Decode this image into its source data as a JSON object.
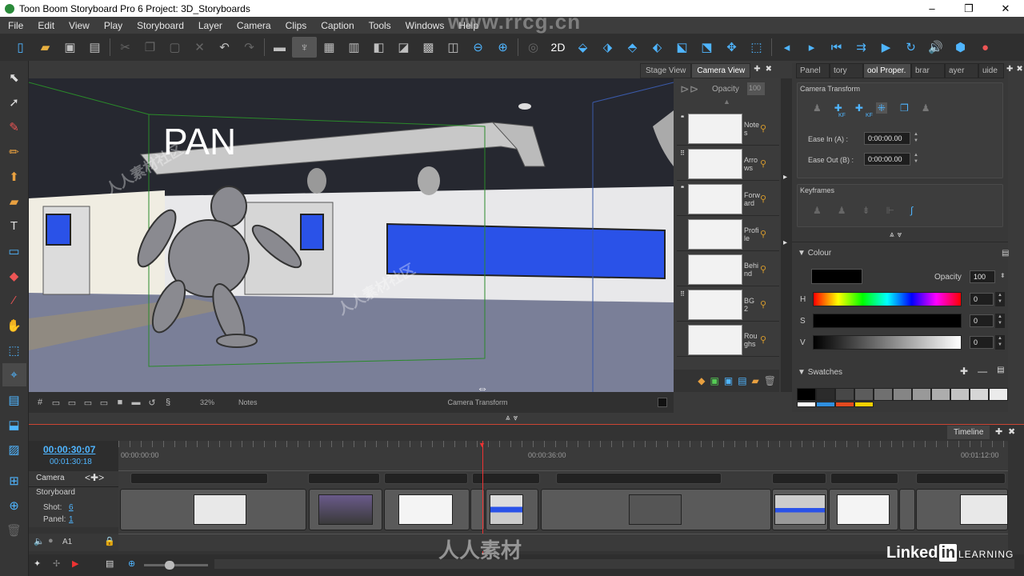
{
  "window": {
    "title": "Toon Boom Storyboard Pro 6 Project: 3D_Storyboards",
    "controls": {
      "minimize": "–",
      "maximize": "❐",
      "close": "✕"
    }
  },
  "menu": [
    "File",
    "Edit",
    "View",
    "Play",
    "Storyboard",
    "Layer",
    "Camera",
    "Clips",
    "Caption",
    "Tools",
    "Windows",
    "Help"
  ],
  "toolbar": {
    "icons": [
      "new-project-icon",
      "open-project-icon",
      "save-icon",
      "save-all-icon",
      "cut-icon",
      "copy-icon",
      "paste-icon",
      "delete-icon",
      "undo-icon",
      "redo-icon",
      "menu-icon",
      "light-table-icon",
      "grid-icon",
      "layout-icon",
      "layout2-icon",
      "layout3-icon",
      "thumbnails-icon",
      "panel-view-icon",
      "zoom-out-icon",
      "zoom-in-icon",
      "3d-mode-icon",
      "2d-label",
      "camera-icon",
      "camera2-icon",
      "camera3-icon",
      "camera4-icon",
      "camera5-icon",
      "camera6-icon",
      "camera7-icon",
      "prev-icon",
      "next-icon",
      "first-frame-icon",
      "playback-icon",
      "play-icon",
      "loop-icon",
      "sound-icon",
      "sound-scrub-icon",
      "render-icon"
    ],
    "label_2d": "2D"
  },
  "stage": {
    "tabs": [
      {
        "label": "Stage View",
        "active": false
      },
      {
        "label": "Camera View",
        "active": true
      }
    ],
    "caption_text": "PAN",
    "zoom": "32%",
    "notes_label": "Notes",
    "camera_transform_label": "Camera Transform"
  },
  "layers": {
    "opacity_label": "Opacity",
    "opacity_value": "100",
    "items": [
      {
        "name": "Notes"
      },
      {
        "name": "Arrows"
      },
      {
        "name": "Forward"
      },
      {
        "name": "Profile"
      },
      {
        "name": "Behind"
      },
      {
        "name": "BG 2"
      },
      {
        "name": "Roughs"
      }
    ]
  },
  "properties": {
    "tabs": [
      {
        "label": "Panel",
        "active": false
      },
      {
        "label": "tory",
        "active": false
      },
      {
        "label": "ool Proper.",
        "active": true
      },
      {
        "label": "brar",
        "active": false
      },
      {
        "label": "ayer",
        "active": false
      },
      {
        "label": "uide",
        "active": false
      }
    ],
    "camera_transform": {
      "title": "Camera Transform",
      "ease_in_label": "Ease In (A) :",
      "ease_in_value": "0:00:00.00",
      "ease_out_label": "Ease Out (B) :",
      "ease_out_value": "0:00:00.00",
      "kf_label": "KF"
    },
    "keyframes": {
      "title": "Keyframes"
    },
    "colour": {
      "title": "Colour",
      "opacity_label": "Opacity",
      "opacity_value": "100",
      "swatch_color": "#000000",
      "h_label": "H",
      "h_value": "0",
      "s_label": "S",
      "s_value": "0",
      "v_label": "V",
      "v_value": "0"
    },
    "swatches": {
      "title": "Swatches",
      "colors": [
        "#000000",
        "#2b2b2b",
        "#474747",
        "#5c5c5c",
        "#707070",
        "#858585",
        "#999999",
        "#adadad",
        "#c2c2c2",
        "#d6d6d6",
        "#ebebeb"
      ],
      "colors_row2": [
        "#ffffff",
        "#2f8fdf",
        "#e34a1f",
        "#f5d000"
      ]
    }
  },
  "timeline": {
    "tab_label": "Timeline",
    "current_time": "00:00:30:07",
    "total_time": "00:01:30:18",
    "ruler": [
      "00:00:00:00",
      "00:00:36:00",
      "00:01:12:00"
    ],
    "track_camera": "Camera",
    "track_storyboard": "Storyboard",
    "shot_label": "Shot:",
    "shot_value": "6",
    "panel_label": "Panel:",
    "panel_value": "1",
    "audio_track": "A1"
  },
  "watermarks": {
    "top": "www.rrcg.cn",
    "bottom": "人人素材",
    "linkedin": "Linked",
    "linkedin_in": "in",
    "learning": "LEARNING"
  }
}
